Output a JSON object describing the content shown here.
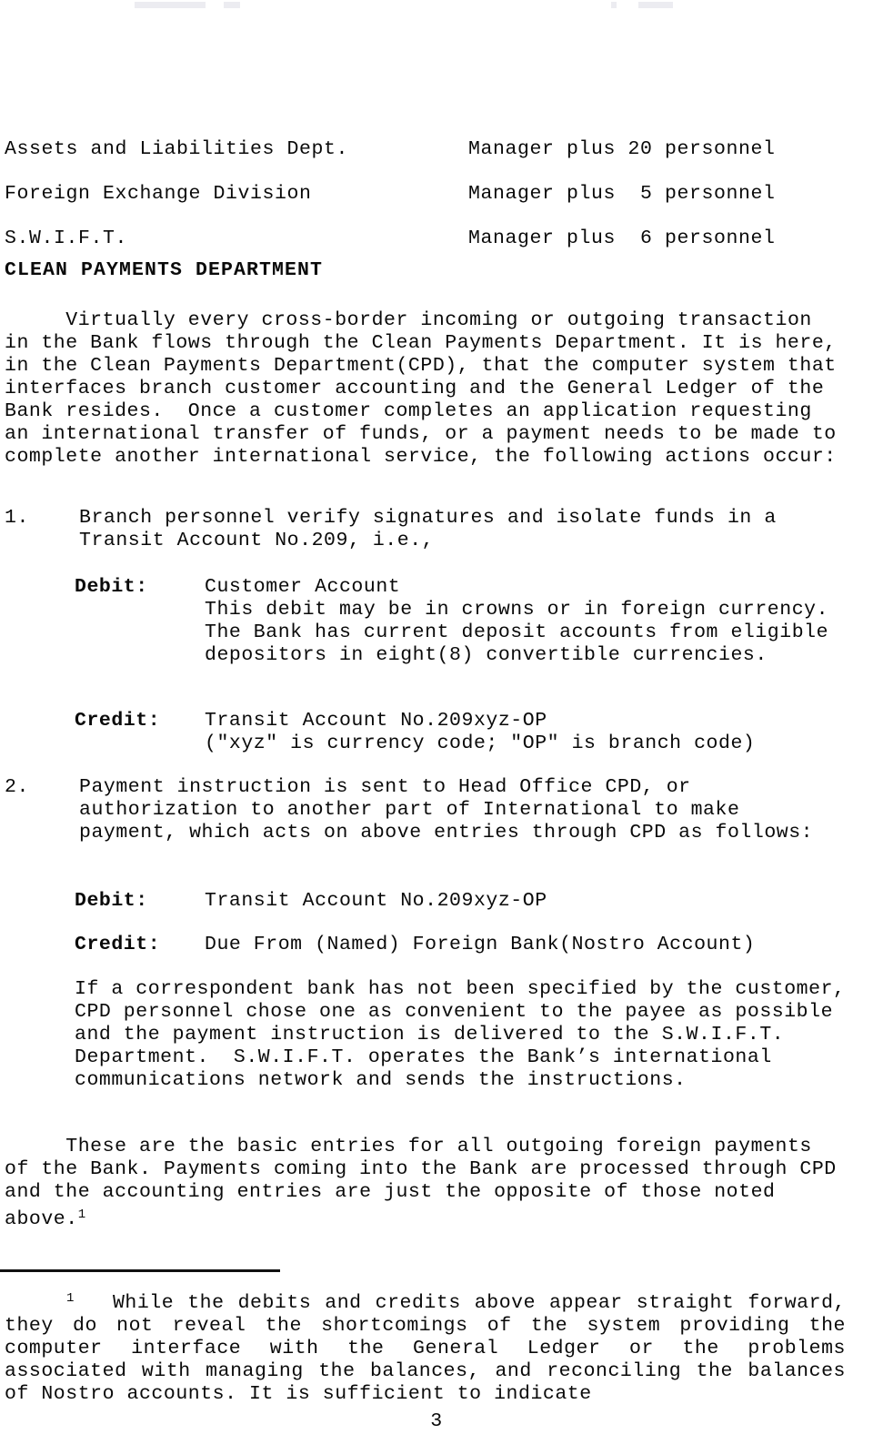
{
  "document": {
    "page_number": "3"
  },
  "staffing": {
    "rows": [
      {
        "department": "Assets and Liabilities Dept.",
        "staffing": "Manager plus 20 personnel"
      },
      {
        "department": "Foreign Exchange Division",
        "staffing": "Manager plus  5 personnel"
      },
      {
        "department": "S.W.I.F.T.",
        "staffing": "Manager plus  6 personnel"
      }
    ]
  },
  "section": {
    "heading": "CLEAN PAYMENTS DEPARTMENT",
    "intro_paragraph": "     Virtually every cross-border incoming or outgoing transaction in the Bank flows through the Clean Payments Department. It is here, in the Clean Payments Department(CPD), that the computer system that interfaces branch customer accounting and the General Ledger of the Bank resides.  Once a customer completes an application requesting an international transfer of funds, or a payment needs to be made to complete another international service, the following actions occur:"
  },
  "steps": [
    {
      "marker": "1.",
      "text": "Branch personnel verify signatures and isolate funds in a Transit Account No.209, i.e.,",
      "entries": [
        {
          "label": "Debit:",
          "value": "Customer Account\nThis debit may be in crowns or in foreign currency.  The Bank has current deposit accounts from eligible depositors in eight(8) convertible currencies."
        },
        {
          "label": "Credit:",
          "value": "Transit Account No.209xyz-OP\n(\"xyz\" is currency code; \"OP\" is branch code)"
        }
      ]
    },
    {
      "marker": "2.",
      "text": "Payment instruction is sent to Head Office CPD, or authorization to another part of International to make payment, which acts on above entries through CPD as follows:",
      "entries": [
        {
          "label": "Debit:",
          "value": "Transit Account No.209xyz-OP"
        },
        {
          "label": "Credit:",
          "value": "Due From (Named) Foreign Bank(Nostro Account)"
        }
      ]
    }
  ],
  "paragraphs": {
    "correspondent_bank": "If a correspondent bank has not been specified by the customer, CPD personnel chose one as convenient to the payee as possible and the payment instruction is delivered to the S.W.I.F.T. Department.  S.W.I.F.T. operates the Bank’s international communications network and sends the instructions.",
    "basic_entries_pre": "     These are the basic entries for all outgoing foreign payments of the Bank. Payments coming into the Bank are processed through CPD and the accounting entries are just the opposite of those noted above.",
    "basic_entries_ref": "1"
  },
  "footnote": {
    "marker": "1",
    "text": "While the debits and credits above appear straight forward, they do not reveal the shortcomings of the system providing the computer interface with the General Ledger or the problems associated with managing the balances, and reconciling the balances of Nostro accounts. It is sufficient to indicate"
  }
}
